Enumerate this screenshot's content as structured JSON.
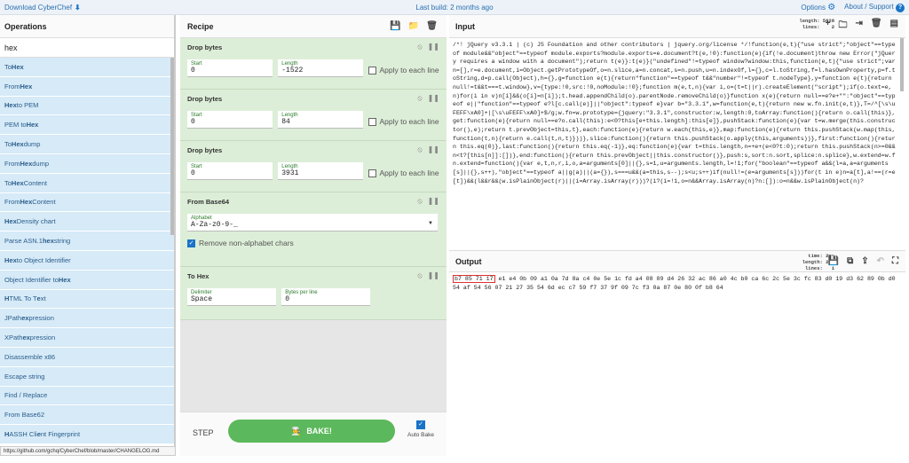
{
  "topbar": {
    "download": "Download CyberChef",
    "build": "Last build: 2 months ago",
    "options": "Options",
    "about": "About / Support"
  },
  "ops": {
    "header": "Operations",
    "search": "hex",
    "items": [
      {
        "pre": "To ",
        "hl": "Hex",
        "post": ""
      },
      {
        "pre": "From ",
        "hl": "Hex",
        "post": ""
      },
      {
        "pre": "",
        "hl": "Hex",
        "post": " to PEM"
      },
      {
        "pre": "PEM to ",
        "hl": "Hex",
        "post": ""
      },
      {
        "pre": "To ",
        "hl": "Hex",
        "post": "dump"
      },
      {
        "pre": "From ",
        "hl": "Hex",
        "post": "dump"
      },
      {
        "pre": "To ",
        "hl": "Hex",
        "post": " Content"
      },
      {
        "pre": "From ",
        "hl": "Hex",
        "post": " Content"
      },
      {
        "pre": "",
        "hl": "Hex",
        "post": " Density chart"
      },
      {
        "pre": "Parse ASN.1 ",
        "hl": "hex",
        "post": " string"
      },
      {
        "pre": "",
        "hl": "Hex",
        "post": " to Object Identifier"
      },
      {
        "pre": "Object Identifier to ",
        "hl": "Hex",
        "post": ""
      },
      {
        "pre": "",
        "hl": "H",
        "post": "TML To T",
        "hl2": "e",
        "post2": "xt"
      },
      {
        "pre": "JPath ",
        "hl": "ex",
        "post": "pression"
      },
      {
        "pre": "XPath ",
        "hl": "ex",
        "post": "pression"
      },
      {
        "pre": "Disassemble x86",
        "hl": "",
        "post": ""
      },
      {
        "pre": "Escape string",
        "hl": "",
        "post": ""
      },
      {
        "pre": "Find / Replace",
        "hl": "",
        "post": ""
      },
      {
        "pre": "From Base62",
        "hl": "",
        "post": ""
      },
      {
        "pre": "",
        "hl": "H",
        "post": "ASSH Cli",
        "hl2": "e",
        "post2": "nt Fingerprint"
      }
    ],
    "status_url": "https://github.com/gchq/CyberChef/blob/master/CHANGELOG.md"
  },
  "recipe": {
    "header": "Recipe",
    "drop1": {
      "title": "Drop bytes",
      "start_label": "Start",
      "start": "0",
      "length_label": "Length",
      "length": "-1522",
      "apply": "Apply to each line"
    },
    "drop2": {
      "title": "Drop bytes",
      "start_label": "Start",
      "start": "0",
      "length_label": "Length",
      "length": "84",
      "apply": "Apply to each line"
    },
    "drop3": {
      "title": "Drop bytes",
      "start_label": "Start",
      "start": "0",
      "length_label": "Length",
      "length": "3931",
      "apply": "Apply to each line"
    },
    "b64": {
      "title": "From Base64",
      "alpha_label": "Alphabet",
      "alpha": "A-Za-z0-9-_",
      "remove": "Remove non-alphabet chars"
    },
    "tohex": {
      "title": "To Hex",
      "delim_label": "Delimiter",
      "delim": "Space",
      "bpl_label": "Bytes per line",
      "bpl": "0"
    },
    "step": "STEP",
    "bake": "BAKE!",
    "auto": "Auto Bake"
  },
  "input": {
    "header": "Input",
    "stats": "length: 5628\n lines:    2",
    "text": "/*! jQuery v3.3.1 | (c) JS Foundation and other contributors | jquery.org/license */!function(e,t){\"use strict\";\"object\"==typeof module&&\"object\"==typeof module.exports?module.exports=e.document?t(e,!0):function(e){if(!e.document)throw new Error(\"jQuery requires a window with a document\");return t(e)}:t(e)}(\"undefined\"!=typeof window?window:this,function(e,t){\"use strict\";var n=[],r=e.document,i=Object.getPrototypeOf,o=n.slice,a=n.concat,s=n.push,u=n.indexOf,l={},c=l.toString,f=l.hasOwnProperty,p=f.toString,d=p.call(Object),h={},g=function e(t){return\"function\"==typeof t&&\"number\"!=typeof t.nodeType},y=function e(t){return null!=t&&t===t.window},v={type:!0,src:!0,noModule:!0};function m(e,t,n){var i,o=(t=t||r).createElement(\"script\");if(o.text=e,n)for(i in v)n[i]&&(o[i]=n[i]);t.head.appendChild(o).parentNode.removeChild(o)}function x(e){return null==e?e+\"\":\"object\"==typeof e||\"function\"==typeof e?l[c.call(e)]||\"object\":typeof e}var b=\"3.3.1\",w=function(e,t){return new w.fn.init(e,t)},T=/^[\\s\\uFEFF\\xA0]+|[\\s\\uFEFF\\xA0]+$/g;w.fn=w.prototype={jquery:\"3.3.1\",constructor:w,length:0,toArray:function(){return o.call(this)},get:function(e){return null==e?o.call(this):e<0?this[e+this.length]:this[e]},pushStack:function(e){var t=w.merge(this.constructor(),e);return t.prevObject=this,t},each:function(e){return w.each(this,e)},map:function(e){return this.pushStack(w.map(this,function(t,n){return e.call(t,n,t)}))},slice:function(){return this.pushStack(o.apply(this,arguments))},first:function(){return this.eq(0)},last:function(){return this.eq(-1)},eq:function(e){var t=this.length,n=+e+(e<0?t:0);return this.pushStack(n>=0&&n<t?[this[n]]:[])},end:function(){return this.prevObject||this.constructor()},push:s,sort:n.sort,splice:n.splice},w.extend=w.fn.extend=function(){var e,t,n,r,i,o,a=arguments[0]||{},s=1,u=arguments.length,l=!1;for(\"boolean\"==typeof a&&(l=a,a=arguments[s]||{},s++),\"object\"==typeof a||g(a)||(a={}),s===u&&(a=this,s--);s<u;s++)if(null!=(e=arguments[s]))for(t in e)n=a[t],a!==(r=e[t])&&(l&&r&&(w.isPlainObject(r)||(i=Array.isArray(r)))?(i?(i=!1,o=n&&Array.isArray(n)?n:[]):o=n&&w.isPlainObject(n)?"
  },
  "output": {
    "header": "Output",
    "stats": "time: 2ms\nlength: 203\n lines:   1",
    "highlight": "b7 85 71 17",
    "text": " e1 e4 0b 09 a1 0a 7d 8a c4 0e 5e 1c fd a4 08 09 d4 26 32 ac 86 a0 4c b0 ca 6c 2c 5e 3c fc 83 d0 19 d3 62 89 0b d0 54 af 54 56 07 21 27 35 54 6d ec c7 59 f7 37 9f 09 7c f3 0a 87 0e 80 0f b8 64"
  }
}
